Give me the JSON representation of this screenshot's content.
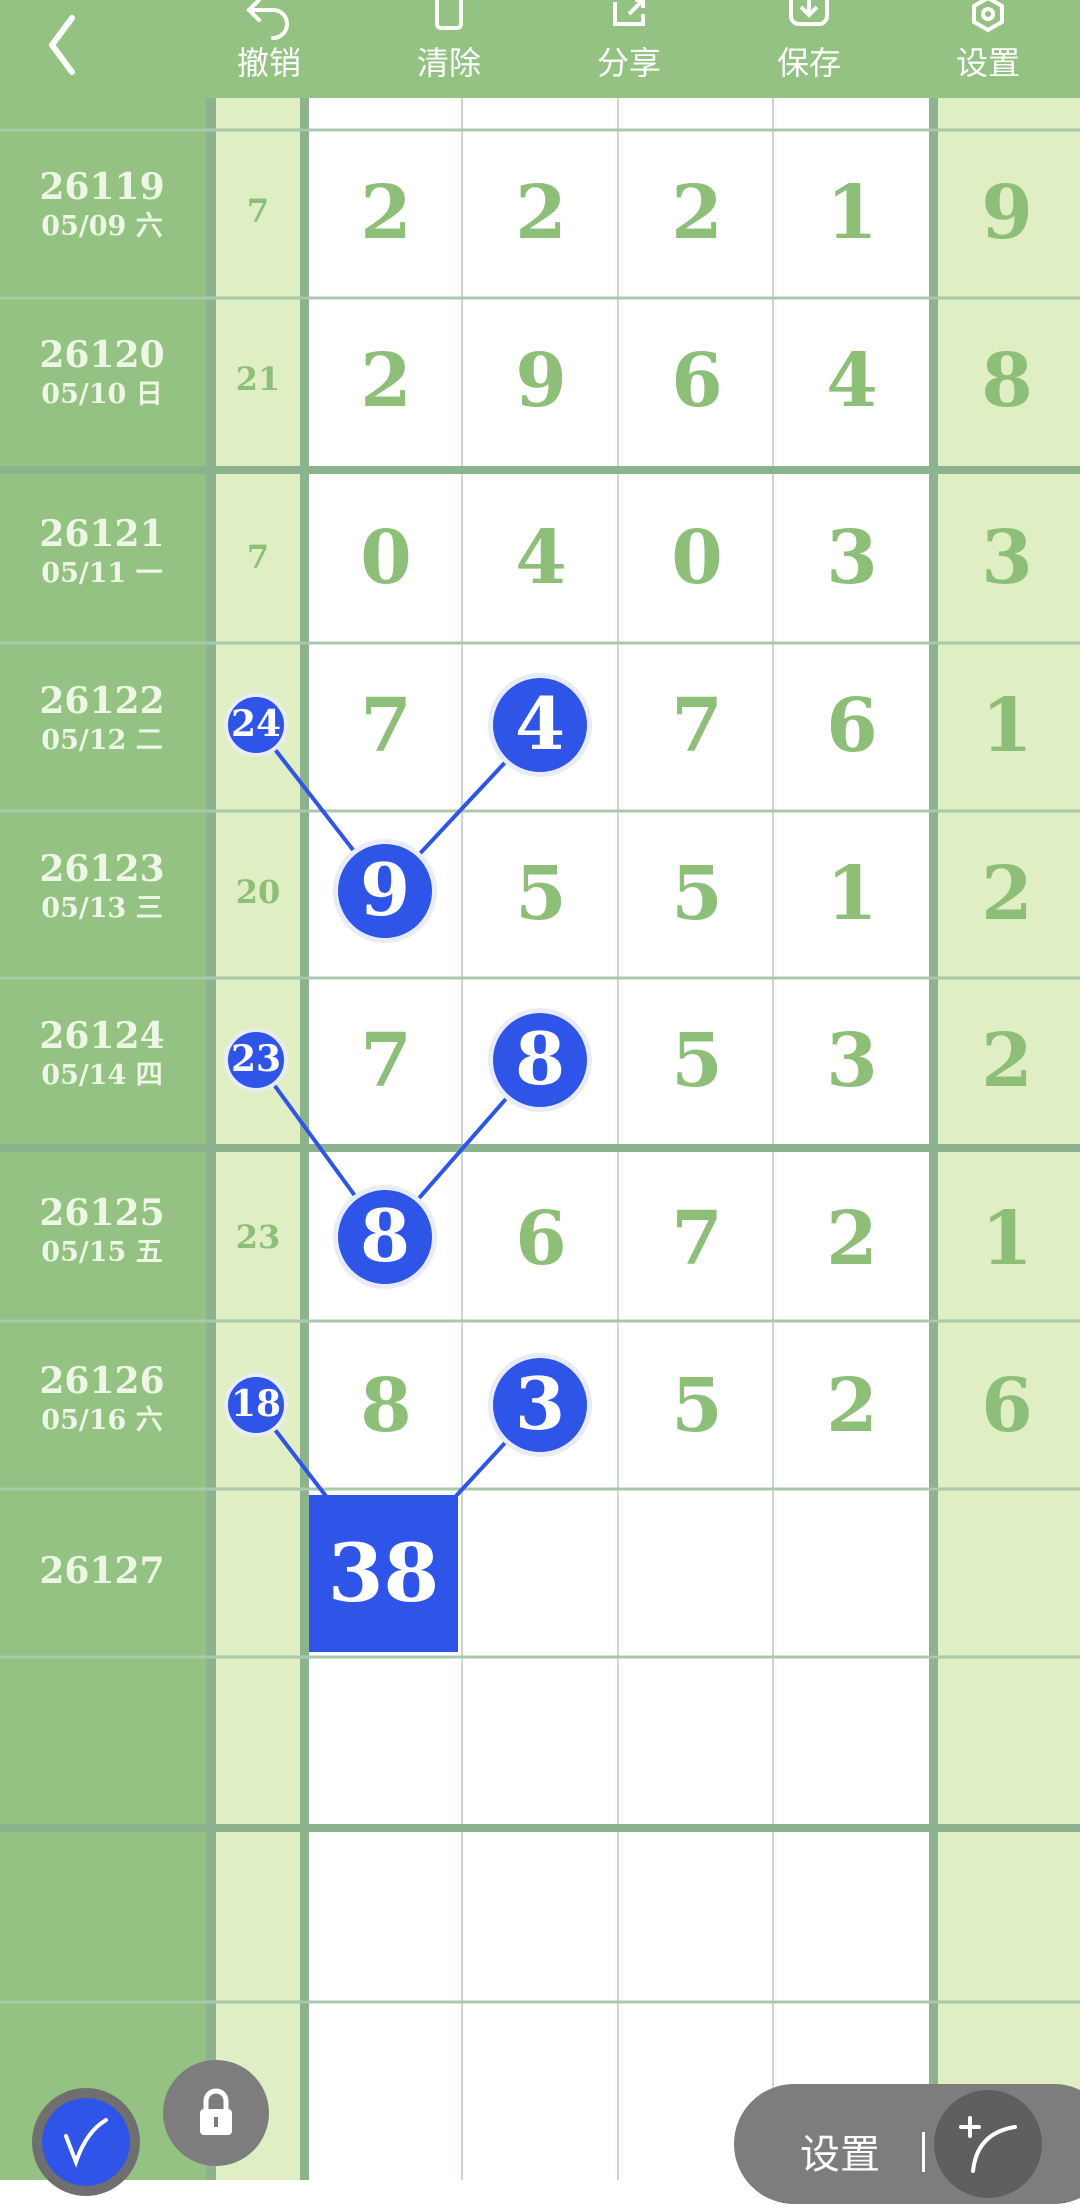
{
  "toolbar": {
    "back_icon": "chevron-left-icon",
    "buttons": [
      {
        "label": "撤销",
        "icon": "undo-icon"
      },
      {
        "label": "清除",
        "icon": "trash-icon"
      },
      {
        "label": "分享",
        "icon": "share-icon"
      },
      {
        "label": "保存",
        "icon": "download-icon"
      },
      {
        "label": "设置",
        "icon": "settings-icon"
      }
    ]
  },
  "rows": [
    {
      "period": "26119",
      "date": "05/09 六",
      "sum": "7",
      "digits": [
        "2",
        "2",
        "2",
        "1"
      ],
      "extra": "9"
    },
    {
      "period": "26120",
      "date": "05/10 日",
      "sum": "21",
      "digits": [
        "2",
        "9",
        "6",
        "4"
      ],
      "extra": "8"
    },
    {
      "period": "26121",
      "date": "05/11 一",
      "sum": "7",
      "digits": [
        "0",
        "4",
        "0",
        "3"
      ],
      "extra": "3"
    },
    {
      "period": "26122",
      "date": "05/12 二",
      "sum": "24",
      "digits": [
        "7",
        "4",
        "7",
        "6"
      ],
      "extra": "1"
    },
    {
      "period": "26123",
      "date": "05/13 三",
      "sum": "20",
      "digits": [
        "9",
        "5",
        "5",
        "1"
      ],
      "extra": "2"
    },
    {
      "period": "26124",
      "date": "05/14 四",
      "sum": "23",
      "digits": [
        "7",
        "8",
        "5",
        "3"
      ],
      "extra": "2"
    },
    {
      "period": "26125",
      "date": "05/15 五",
      "sum": "23",
      "digits": [
        "8",
        "6",
        "7",
        "2"
      ],
      "extra": "1"
    },
    {
      "period": "26126",
      "date": "05/16 六",
      "sum": "18",
      "digits": [
        "8",
        "3",
        "5",
        "2"
      ],
      "extra": "6"
    },
    {
      "period": "26127",
      "date": "",
      "sum": "",
      "digits": [
        "",
        "",
        "",
        ""
      ],
      "extra": ""
    }
  ],
  "prediction": {
    "value": "38"
  },
  "bottom": {
    "pen_icon": "pen-icon",
    "lock_icon": "lock-icon",
    "settings_label": "设置",
    "line_tool_icon": "curve-line-icon"
  },
  "colors": {
    "toolbar_bg": "#94c283",
    "date_col_bg": "#94c283",
    "light_col_bg": "#dfeec3",
    "digit_text": "#8ebf78",
    "highlight_blue": "#2f54e8",
    "grid_line": "#8cb28e"
  }
}
